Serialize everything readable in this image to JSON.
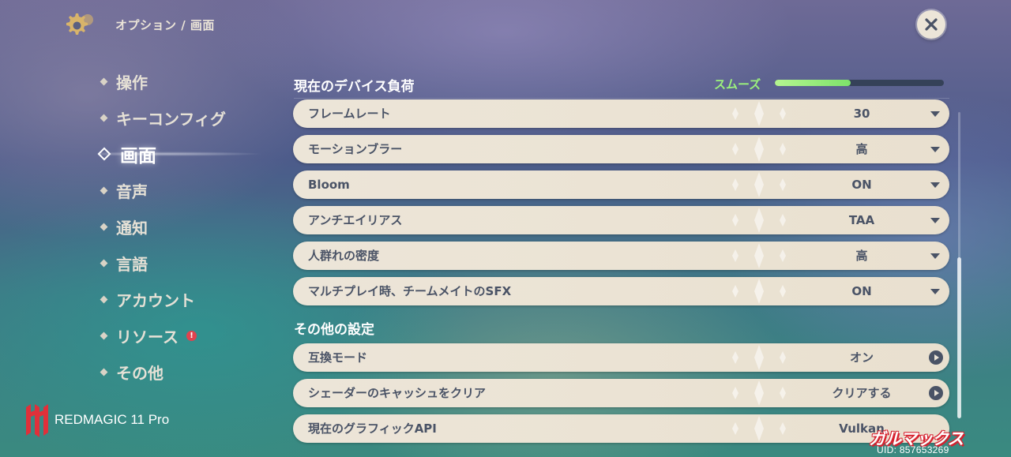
{
  "header": {
    "breadcrumb": "オプション / 画面",
    "settings_icon": "gear-icon",
    "close_icon": "close-icon"
  },
  "sidebar": {
    "items": [
      {
        "label": "操作",
        "active": false
      },
      {
        "label": "キーコンフィグ",
        "active": false
      },
      {
        "label": "画面",
        "active": true
      },
      {
        "label": "音声",
        "active": false
      },
      {
        "label": "通知",
        "active": false
      },
      {
        "label": "言語",
        "active": false
      },
      {
        "label": "アカウント",
        "active": false
      },
      {
        "label": "リソース",
        "active": false,
        "alert": "!"
      },
      {
        "label": "その他",
        "active": false
      }
    ]
  },
  "device": {
    "name": "REDMAGIC 11 Pro"
  },
  "main": {
    "device_load": {
      "title": "現在のデバイス負荷",
      "status": "スムーズ",
      "level_percent": 45
    },
    "settings": [
      {
        "label": "フレームレート",
        "value": "30",
        "control": "dropdown"
      },
      {
        "label": "モーションブラー",
        "value": "高",
        "control": "dropdown"
      },
      {
        "label": "Bloom",
        "value": "ON",
        "control": "dropdown"
      },
      {
        "label": "アンチエイリアス",
        "value": "TAA",
        "control": "dropdown"
      },
      {
        "label": "人群れの密度",
        "value": "高",
        "control": "dropdown"
      },
      {
        "label": "マルチプレイ時、チームメイトのSFX",
        "value": "ON",
        "control": "dropdown"
      }
    ],
    "other": {
      "title": "その他の設定",
      "settings": [
        {
          "label": "互換モード",
          "value": "オン",
          "control": "action"
        },
        {
          "label": "シェーダーのキャッシュをクリア",
          "value": "クリアする",
          "control": "action"
        },
        {
          "label": "現在のグラフィックAPI",
          "value": "Vulkan",
          "control": "none"
        }
      ]
    }
  },
  "footer": {
    "uid": "UID: 857653269",
    "watermark": "ガルマックス"
  },
  "colors": {
    "row_background": "#ece5d8",
    "row_text": "#4a5366",
    "load_status": "#9cf27c",
    "alert": "#e0434f"
  }
}
